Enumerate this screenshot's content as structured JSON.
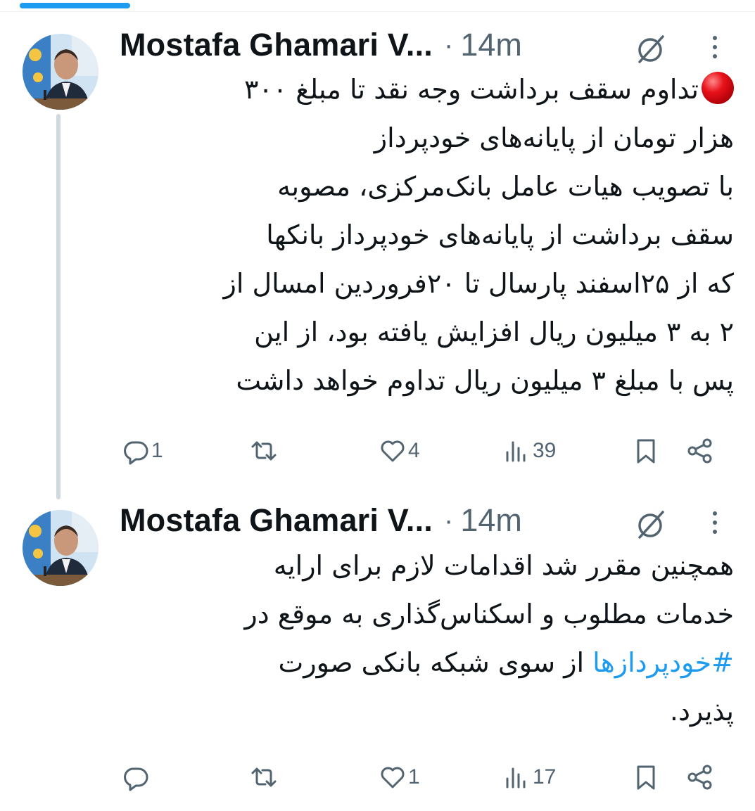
{
  "tweets": [
    {
      "author_name": "Mostafa Ghamari V...",
      "separator": "·",
      "time": "14m",
      "emoji": "red-circle",
      "lines": [
        "تداوم سقف برداشت وجه نقد تا مبلغ ۳۰۰",
        "هزار تومان از پایانه‌های خودپرداز",
        "با تصویب هیات عامل بانک‌مرکزی، مصوبه",
        "سقف برداشت از پایانه‌های  خودپرداز بانکها",
        "که از ۲۵اسفند پارسال تا ۲۰فروردین امسال از",
        "۲ به ۳ میلیون ریال افزایش یافته بود، از این",
        "پس با مبلغ ۳ میلیون ریال تداوم خواهد داشت"
      ],
      "actions": {
        "replies": "1",
        "retweets": "",
        "likes": "4",
        "views": "39"
      }
    },
    {
      "author_name": "Mostafa Ghamari V...",
      "separator": "·",
      "time": "14m",
      "lines": [
        "همچنین مقرر شد اقدامات لازم برای ارایه",
        "خدمات مطلوب و اسکناس‌گذاری به موقع در",
        "از سوی شبکه بانکی صورت",
        "پذیرد."
      ],
      "hashtag": "#خودپردازها",
      "actions": {
        "replies": "",
        "retweets": "",
        "likes": "1",
        "views": "17"
      }
    }
  ],
  "colors": {
    "accent": "#1d9bf0",
    "text": "#0f1419",
    "secondary": "#536471",
    "thread_line": "#cfd9de"
  },
  "icons": [
    "reply-icon",
    "retweet-icon",
    "like-icon",
    "views-icon",
    "bookmark-icon",
    "share-icon",
    "grok-icon",
    "more-icon"
  ]
}
